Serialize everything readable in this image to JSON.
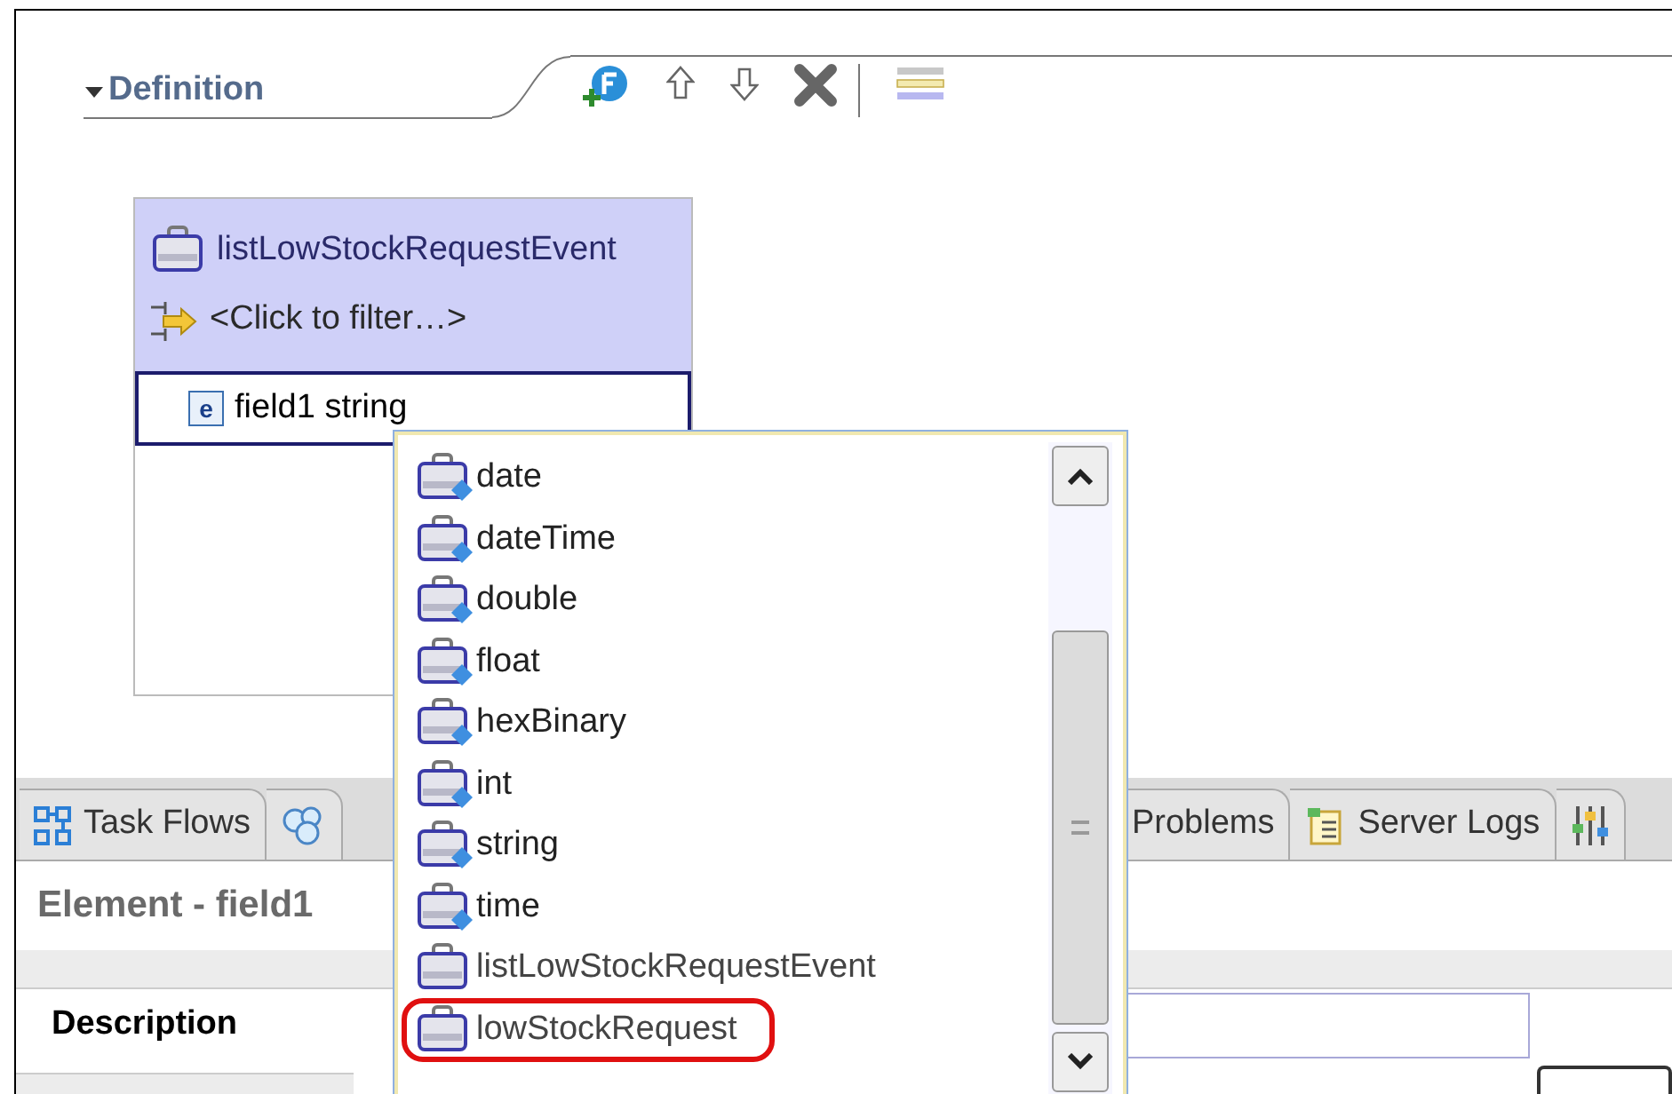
{
  "section": {
    "title": "Definition",
    "expanded": true
  },
  "business_object": {
    "name": "listLowStockRequestEvent",
    "filter": "<Click to filter…>",
    "fields": [
      {
        "glyph": "e",
        "label": "field1 string",
        "selected": true
      }
    ]
  },
  "type_menu": {
    "items": [
      {
        "label": "date",
        "kind": "simple",
        "highlighted": false
      },
      {
        "label": "dateTime",
        "kind": "simple",
        "highlighted": false
      },
      {
        "label": "double",
        "kind": "simple",
        "highlighted": false
      },
      {
        "label": "float",
        "kind": "simple",
        "highlighted": false
      },
      {
        "label": "hexBinary",
        "kind": "simple",
        "highlighted": false
      },
      {
        "label": "int",
        "kind": "simple",
        "highlighted": false
      },
      {
        "label": "string",
        "kind": "simple",
        "highlighted": false
      },
      {
        "label": "time",
        "kind": "simple",
        "highlighted": false
      },
      {
        "label": "listLowStockRequestEvent",
        "kind": "complex",
        "highlighted": false
      },
      {
        "label": "lowStockRequest",
        "kind": "complex",
        "highlighted": true
      }
    ]
  },
  "bottom_panel": {
    "tabs": [
      {
        "label": "Task Flows",
        "kind": "flows"
      },
      {
        "kind": "circles"
      },
      {
        "label": "Problems",
        "kind": "problems"
      },
      {
        "label": "Server Logs",
        "kind": "logs"
      },
      {
        "kind": "sliders"
      }
    ],
    "title": "Element - field1",
    "section": "Description"
  }
}
